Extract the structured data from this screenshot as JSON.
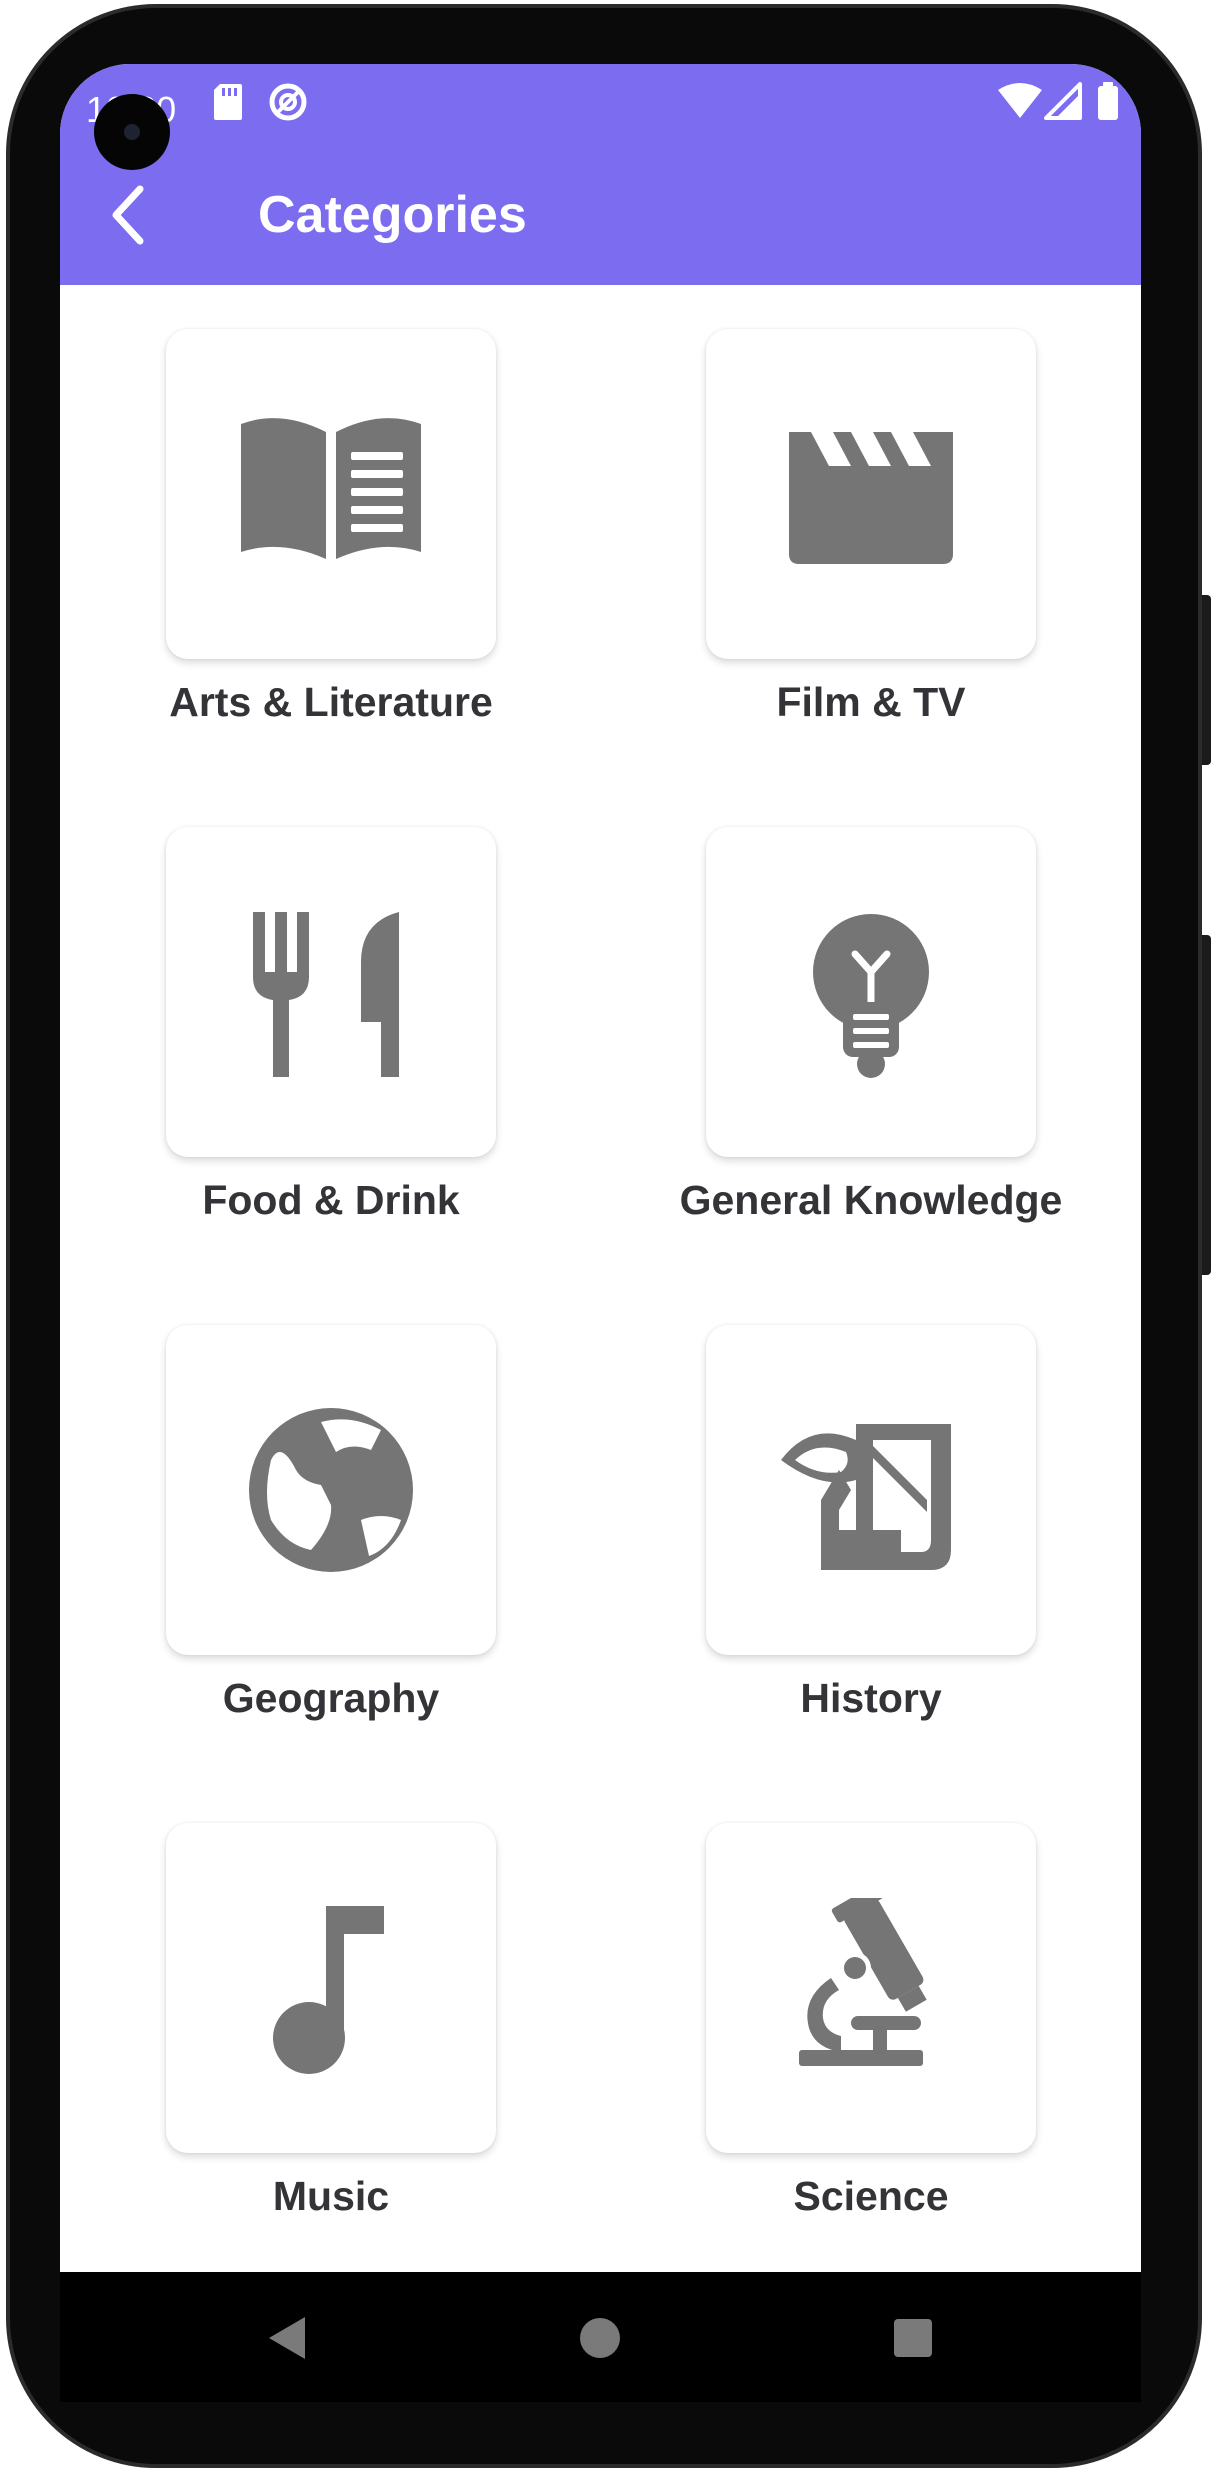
{
  "status_bar": {
    "time": "10:20"
  },
  "app_bar": {
    "title": "Categories",
    "back_icon": "arrow-back-icon",
    "background_color": "#7b6cf0"
  },
  "categories": [
    {
      "label": "Arts & Literature",
      "icon": "open-book-icon"
    },
    {
      "label": "Film & TV",
      "icon": "clapperboard-icon"
    },
    {
      "label": "Food & Drink",
      "icon": "fork-knife-icon"
    },
    {
      "label": "General Knowledge",
      "icon": "lightbulb-icon"
    },
    {
      "label": "Geography",
      "icon": "globe-icon"
    },
    {
      "label": "History",
      "icon": "history-scroll-icon"
    },
    {
      "label": "Music",
      "icon": "music-note-icon"
    },
    {
      "label": "Science",
      "icon": "microscope-icon"
    }
  ],
  "icon_color": "#757575",
  "nav_bar": {
    "back_icon": "nav-back-triangle-icon",
    "home_icon": "nav-home-circle-icon",
    "recents_icon": "nav-recents-square-icon"
  }
}
